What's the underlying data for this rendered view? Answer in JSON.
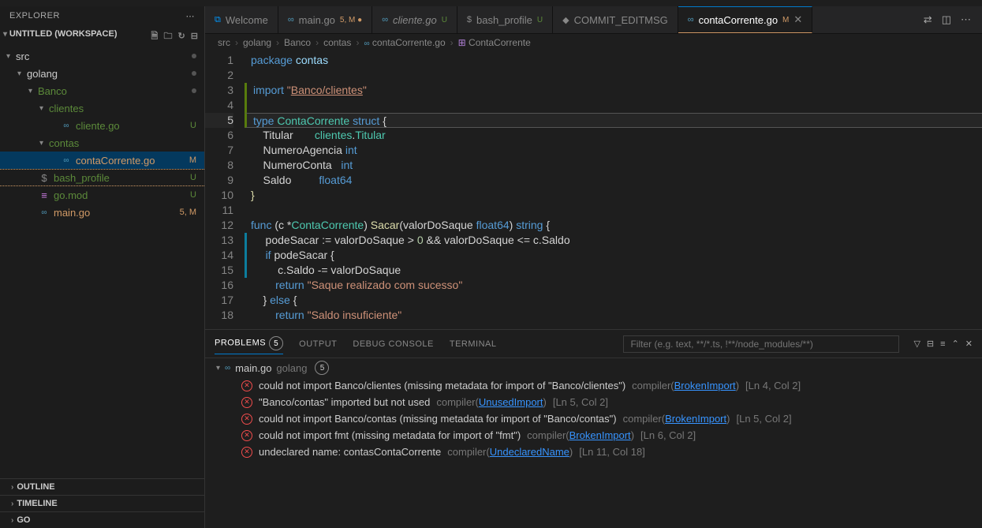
{
  "sidebar": {
    "title": "EXPLORER",
    "workspace": "UNTITLED (WORKSPACE)",
    "tree": [
      {
        "depth": 0,
        "chev": "▾",
        "icon": "",
        "label": "src",
        "status": "",
        "dot": true
      },
      {
        "depth": 1,
        "chev": "▾",
        "icon": "",
        "label": "golang",
        "status": "",
        "dot": true
      },
      {
        "depth": 2,
        "chev": "▾",
        "icon": "",
        "label": "Banco",
        "status": "",
        "cls": "folder-unt",
        "dot": true
      },
      {
        "depth": 3,
        "chev": "▾",
        "icon": "",
        "label": "clientes",
        "status": "",
        "cls": "folder-unt"
      },
      {
        "depth": 4,
        "chev": "",
        "icon": "go",
        "label": "cliente.go",
        "status": "U",
        "cls": "unt"
      },
      {
        "depth": 3,
        "chev": "▾",
        "icon": "",
        "label": "contas",
        "status": "",
        "cls": "folder-unt"
      },
      {
        "depth": 4,
        "chev": "",
        "icon": "go",
        "label": "contaCorrente.go",
        "status": "M",
        "cls": "mod sel"
      },
      {
        "depth": 2,
        "chev": "",
        "icon": "$",
        "label": "bash_profile",
        "status": "U",
        "cls": "unt dashed"
      },
      {
        "depth": 2,
        "chev": "",
        "icon": "≡",
        "label": "go.mod",
        "status": "U",
        "cls": "unt"
      },
      {
        "depth": 2,
        "chev": "",
        "icon": "go",
        "label": "main.go",
        "status": "5, M",
        "cls": "mod"
      }
    ],
    "sections": [
      "OUTLINE",
      "TIMELINE",
      "GO"
    ]
  },
  "tabs": [
    {
      "icon": "vs",
      "label": "Welcome",
      "stat": "",
      "statColor": ""
    },
    {
      "icon": "go",
      "label": "main.go",
      "stat": "5, M ●",
      "statColor": "#d19a66"
    },
    {
      "icon": "go",
      "label": "cliente.go",
      "stat": "U",
      "statColor": "#5c8a3a",
      "it": true
    },
    {
      "icon": "$",
      "label": "bash_profile",
      "stat": "U",
      "statColor": "#5c8a3a"
    },
    {
      "icon": "◆",
      "label": "COMMIT_EDITMSG",
      "stat": "",
      "statColor": ""
    },
    {
      "icon": "go",
      "label": "contaCorrente.go",
      "stat": "M",
      "statColor": "#d19a66",
      "active": true,
      "close": true
    }
  ],
  "crumbs": [
    "src",
    "golang",
    "Banco",
    "contas",
    "contaCorrente.go",
    "ContaCorrente"
  ],
  "code": {
    "lines": [
      {
        "n": 1,
        "html": "<span class='kw'>package</span> <span class='pkg'>contas</span>"
      },
      {
        "n": 2,
        "html": ""
      },
      {
        "n": 3,
        "html": "<span class='kw'>import</span> <span class='str'>\"<u>Banco/clientes</u>\"</span>",
        "mark": "g"
      },
      {
        "n": 4,
        "html": "",
        "mark": "g"
      },
      {
        "n": 5,
        "html": "<span class='kw'>type</span> <span class='typ'>ContaCorrente</span> <span class='kw'>struct</span> {",
        "hl": true,
        "mark": "g"
      },
      {
        "n": 6,
        "html": "    Titular       <span class='typ'>clientes</span>.<span class='typ'>Titular</span>"
      },
      {
        "n": 7,
        "html": "    NumeroAgencia <span class='kw'>int</span>"
      },
      {
        "n": 8,
        "html": "    NumeroConta   <span class='kw'>int</span>"
      },
      {
        "n": 9,
        "html": "    Saldo         <span class='kw'>float64</span>"
      },
      {
        "n": 10,
        "html": "<span class='fn'>}</span>"
      },
      {
        "n": 11,
        "html": ""
      },
      {
        "n": 12,
        "html": "<span class='kw'>func</span> (c *<span class='typ'>ContaCorrente</span>) <span class='fn'>Sacar</span>(valorDoSaque <span class='kw'>float64</span>) <span class='kw'>string</span> {"
      },
      {
        "n": 13,
        "html": "    podeSacar := valorDoSaque &gt; <span class='num'>0</span> &amp;&amp; valorDoSaque &lt;= c.Saldo",
        "mark": "b"
      },
      {
        "n": 14,
        "html": "    <span class='kw'>if</span> podeSacar {",
        "mark": "b"
      },
      {
        "n": 15,
        "html": "        c.Saldo -= valorDoSaque",
        "mark": "b"
      },
      {
        "n": 16,
        "html": "        <span class='kw'>return</span> <span class='str'>\"Saque realizado com sucesso\"</span>"
      },
      {
        "n": 17,
        "html": "    } <span class='kw'>else</span> {"
      },
      {
        "n": 18,
        "html": "        <span class='kw'>return</span> <span class='str'>\"Saldo insuficiente\"</span>"
      }
    ]
  },
  "panel": {
    "tabs": [
      "PROBLEMS",
      "OUTPUT",
      "DEBUG CONSOLE",
      "TERMINAL"
    ],
    "badge": "5",
    "filterPlaceholder": "Filter (e.g. text, **/*.ts, !**/node_modules/**)",
    "file": {
      "name": "main.go",
      "dir": "golang",
      "badge": "5"
    },
    "errors": [
      {
        "msg": "could not import Banco/clientes (missing metadata for import of \"Banco/clientes\")",
        "src": "compiler",
        "lnk": "BrokenImport",
        "pos": "[Ln 4, Col 2]"
      },
      {
        "msg": "\"Banco/contas\" imported but not used",
        "src": "compiler",
        "lnk": "UnusedImport",
        "pos": "[Ln 5, Col 2]"
      },
      {
        "msg": "could not import Banco/contas (missing metadata for import of \"Banco/contas\")",
        "src": "compiler",
        "lnk": "BrokenImport",
        "pos": "[Ln 5, Col 2]"
      },
      {
        "msg": "could not import fmt (missing metadata for import of \"fmt\")",
        "src": "compiler",
        "lnk": "BrokenImport",
        "pos": "[Ln 6, Col 2]"
      },
      {
        "msg": "undeclared name: contasContaCorrente",
        "src": "compiler",
        "lnk": "UndeclaredName",
        "pos": "[Ln 11, Col 18]"
      }
    ]
  }
}
